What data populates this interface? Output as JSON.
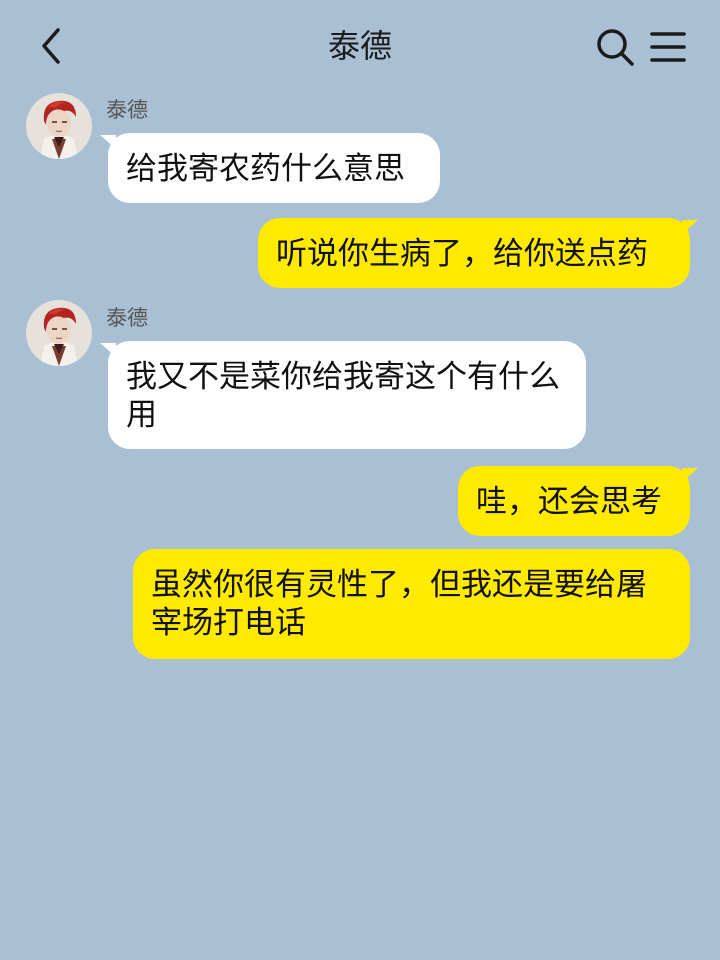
{
  "header": {
    "title": "泰德",
    "back_icon": "chevron-left-icon",
    "search_icon": "search-icon",
    "menu_icon": "menu-icon"
  },
  "messages": [
    {
      "side": "left",
      "sender": "泰德",
      "text": "给我寄农药什么意思"
    },
    {
      "side": "right",
      "text": "听说你生病了，给你送点药"
    },
    {
      "side": "left",
      "sender": "泰德",
      "text": "我又不是菜你给我寄这个有什么用"
    },
    {
      "side": "right",
      "text": "哇，还会思考"
    },
    {
      "side": "right",
      "text": "虽然你很有灵性了，但我还是要给屠宰场打电话"
    }
  ],
  "colors": {
    "background": "#a9bfd3",
    "bubble_self": "#ffea00",
    "bubble_other": "#ffffff"
  }
}
